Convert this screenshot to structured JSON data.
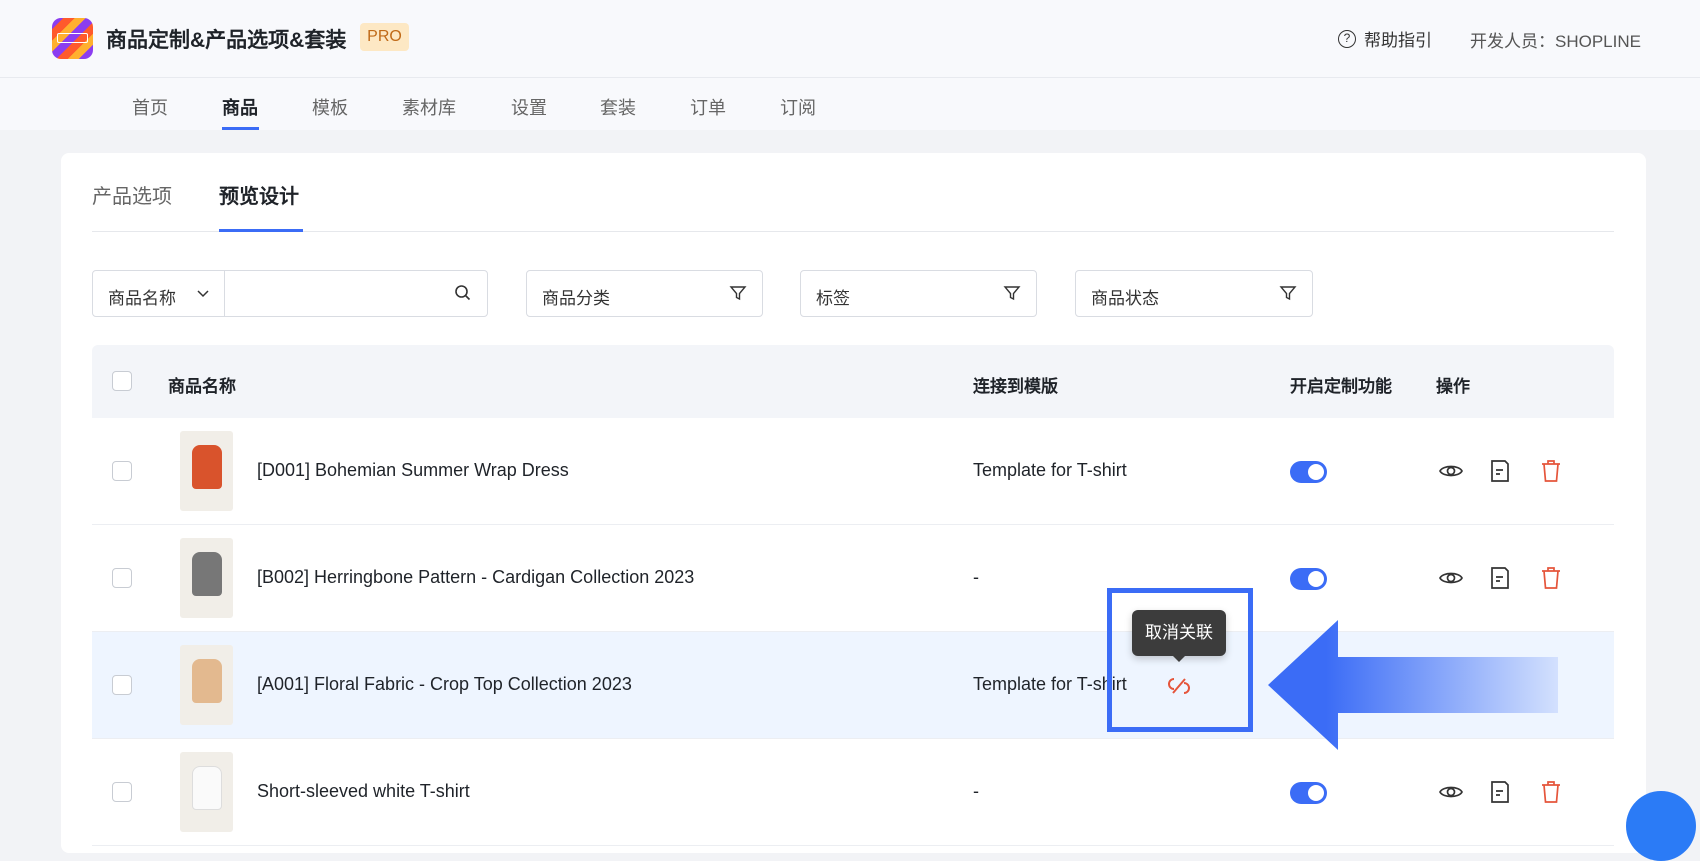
{
  "header": {
    "title": "商品定制&产品选项&套装",
    "badge": "PRO",
    "help": "帮助指引",
    "developer": "开发人员：SHOPLINE"
  },
  "nav": [
    {
      "label": "首页"
    },
    {
      "label": "商品",
      "active": true
    },
    {
      "label": "模板"
    },
    {
      "label": "素材库"
    },
    {
      "label": "设置"
    },
    {
      "label": "套装"
    },
    {
      "label": "订单"
    },
    {
      "label": "订阅"
    }
  ],
  "tabs": [
    {
      "label": "产品选项"
    },
    {
      "label": "预览设计",
      "active": true
    }
  ],
  "filters": {
    "search_field": "商品名称",
    "search_value": "",
    "category": "商品分类",
    "tags": "标签",
    "status": "商品状态"
  },
  "table": {
    "headers": {
      "name": "商品名称",
      "template": "连接到模版",
      "customize": "开启定制功能",
      "actions": "操作"
    },
    "rows": [
      {
        "name": "[D001] Bohemian Summer Wrap Dress",
        "template": "Template for T-shirt",
        "enabled": true
      },
      {
        "name": "[B002] Herringbone Pattern - Cardigan Collection 2023",
        "template": "-",
        "enabled": true
      },
      {
        "name": "[A001] Floral Fabric - Crop Top Collection 2023",
        "template": "Template for T-shirt",
        "enabled": true
      },
      {
        "name": "Short-sleeved white T-shirt",
        "template": "-",
        "enabled": true
      }
    ]
  },
  "tooltip": "取消关联",
  "colors": {
    "accent": "#3b6cf6",
    "danger": "#e5553b"
  }
}
